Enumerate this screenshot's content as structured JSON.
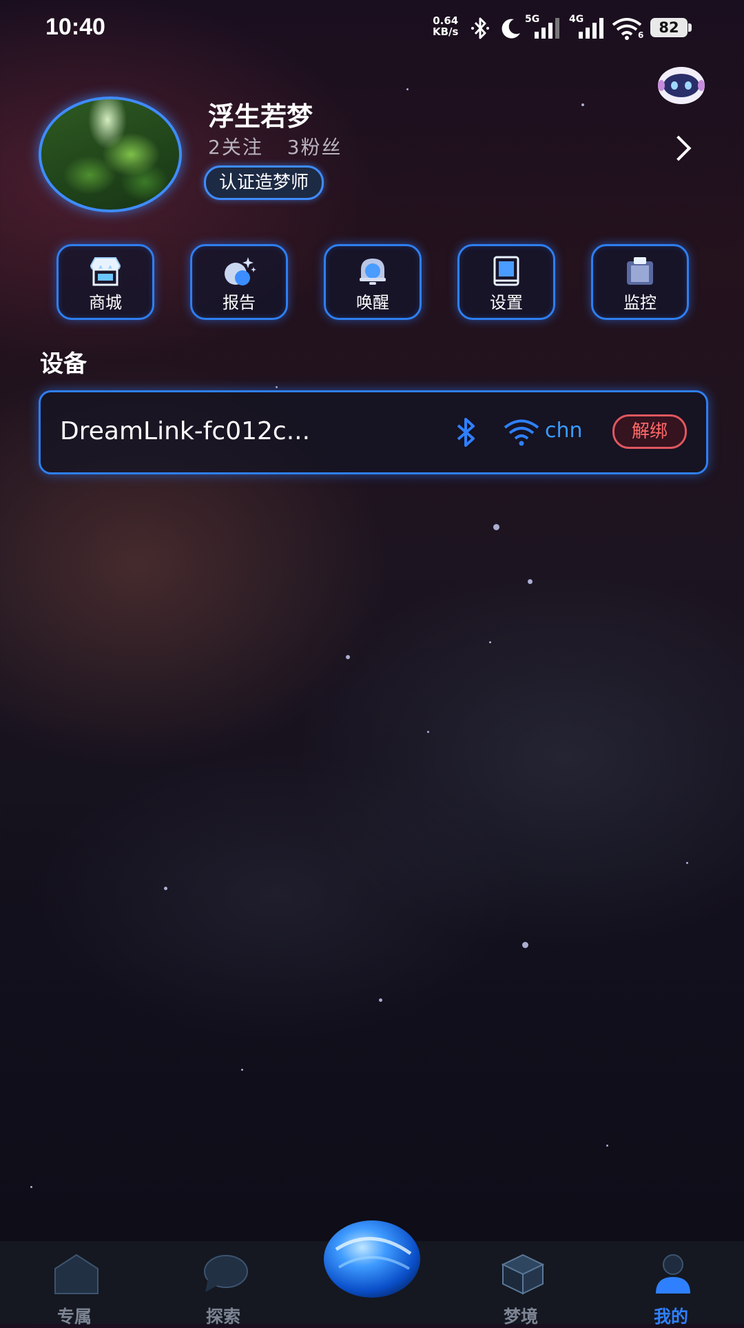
{
  "status_bar": {
    "time": "10:40",
    "net_speed_value": "0.64",
    "net_speed_unit": "KB/s",
    "signal1_label": "5G",
    "signal2_label": "4G",
    "wifi_sub": "6",
    "battery": "82",
    "icons": [
      "bluetooth-icon",
      "moon-icon",
      "signal-icon",
      "signal-icon",
      "wifi-icon",
      "battery-icon"
    ]
  },
  "profile": {
    "name": "浮生若梦",
    "following": "2关注",
    "followers": "3粉丝",
    "badge": "认证造梦师"
  },
  "quick_actions": [
    {
      "label": "商城",
      "icon": "store-icon"
    },
    {
      "label": "报告",
      "icon": "moon-stars-icon"
    },
    {
      "label": "唤醒",
      "icon": "bell-icon"
    },
    {
      "label": "设置",
      "icon": "book-icon"
    },
    {
      "label": "监控",
      "icon": "clipboard-icon"
    }
  ],
  "section_title": "设备",
  "device": {
    "name": "DreamLink-fc012c...",
    "wifi_name": "chn",
    "unbind_label": "解绑"
  },
  "nav": {
    "items": [
      {
        "label": "专属",
        "icon": "home-icon"
      },
      {
        "label": "探索",
        "icon": "chat-bubble-icon"
      },
      {
        "label": "梦境",
        "icon": "cube-icon"
      },
      {
        "label": "我的",
        "icon": "person-icon"
      }
    ],
    "active_index": 3
  },
  "colors": {
    "accent": "#2f80ff",
    "danger": "#e0575f",
    "nav_bg": "#151820"
  }
}
